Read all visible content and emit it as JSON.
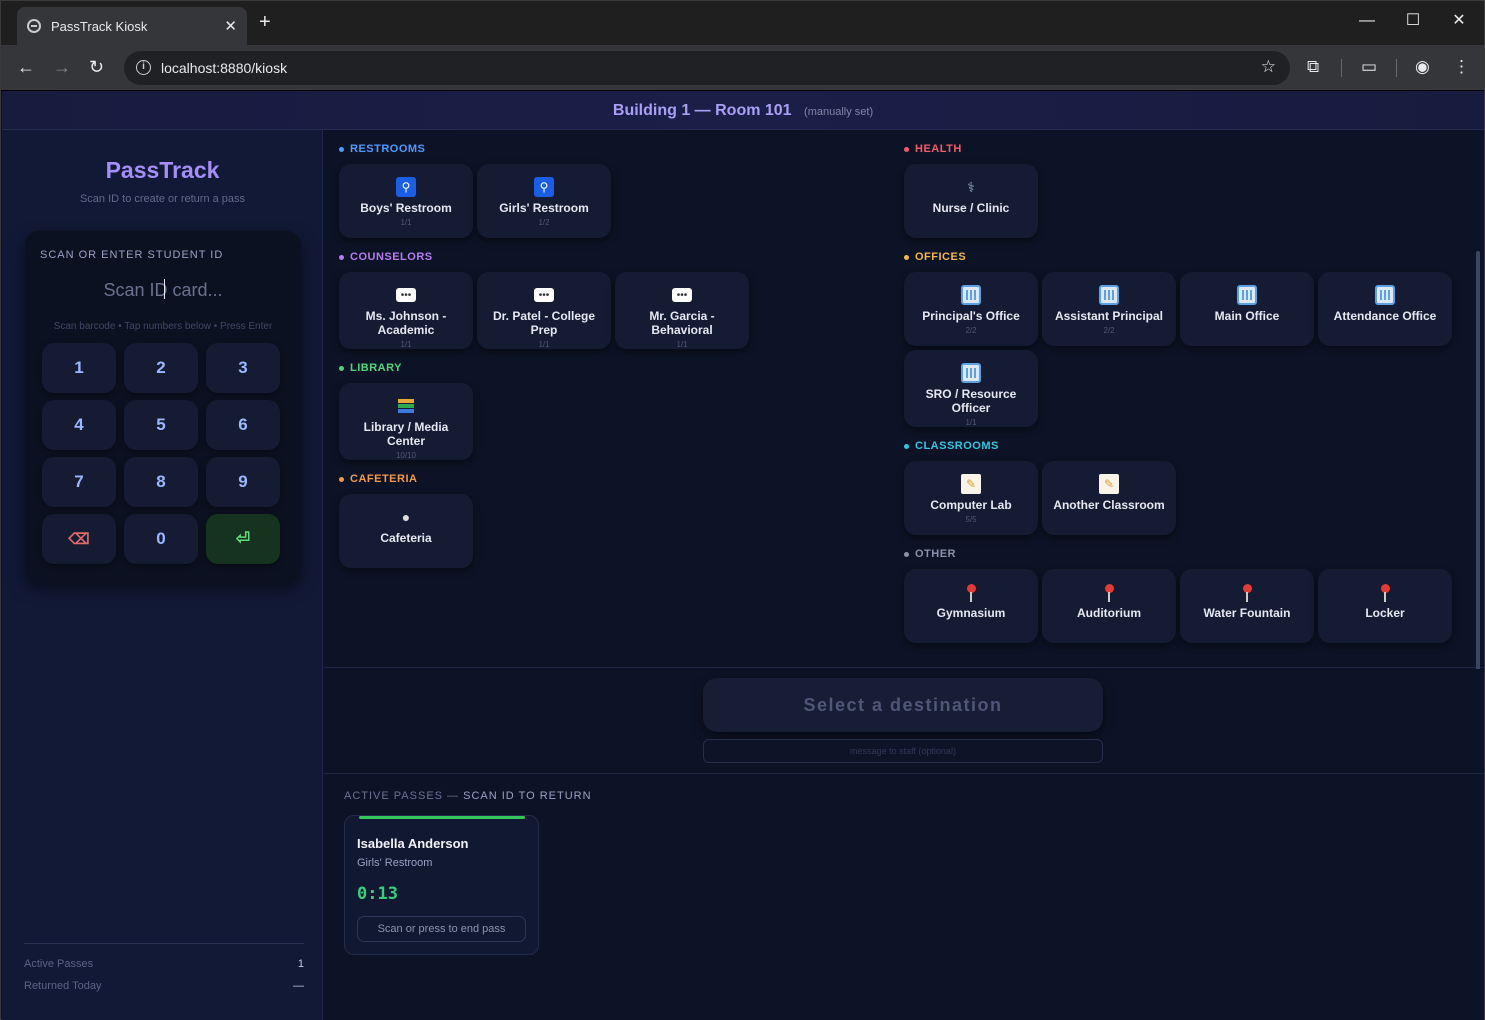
{
  "browser": {
    "tab_title": "PassTrack Kiosk",
    "url": "localhost:8880/kiosk",
    "icons": [
      "globe-icon",
      "close-icon",
      "plus-icon",
      "back-icon",
      "forward-icon",
      "reload-icon",
      "info-icon",
      "star-icon",
      "extensions-icon",
      "media-icon",
      "profile-icon",
      "menu-icon"
    ]
  },
  "topbar": {
    "room": "Building 1 — Room 101",
    "mode": "(manually set)"
  },
  "sidebar": {
    "brand": "PassTrack",
    "tagline": "Scan ID to create or return a pass",
    "scan_label": "SCAN OR ENTER STUDENT ID",
    "scan_placeholder": "Scan ID card...",
    "hint": "Scan barcode • Tap numbers below • Press Enter",
    "keys": [
      "1",
      "2",
      "3",
      "4",
      "5",
      "6",
      "7",
      "8",
      "9",
      "⌫",
      "0",
      "⏎"
    ],
    "stats": [
      {
        "label": "Active Passes",
        "value": "1"
      },
      {
        "label": "Returned Today",
        "value": "—"
      }
    ]
  },
  "categories": {
    "restrooms": {
      "title": "RESTROOMS",
      "color": "#4f9bff",
      "items": [
        {
          "name": "Boys' Restroom",
          "count": "1/1",
          "icon": "restroom-icon"
        },
        {
          "name": "Girls' Restroom",
          "count": "1/2",
          "icon": "restroom-icon"
        }
      ]
    },
    "counselors": {
      "title": "COUNSELORS",
      "color": "#b67cf2",
      "items": [
        {
          "name": "Ms. Johnson - Academic",
          "count": "1/1",
          "icon": "speech-bubble-icon"
        },
        {
          "name": "Dr. Patel - College Prep",
          "count": "1/1",
          "icon": "speech-bubble-icon"
        },
        {
          "name": "Mr. Garcia - Behavioral",
          "count": "1/1",
          "icon": "speech-bubble-icon"
        }
      ]
    },
    "library": {
      "title": "LIBRARY",
      "color": "#4cd67a",
      "items": [
        {
          "name": "Library / Media Center",
          "count": "10/10",
          "icon": "books-icon"
        }
      ]
    },
    "cafeteria": {
      "title": "CAFETERIA",
      "color": "#f2994a",
      "items": [
        {
          "name": "Cafeteria",
          "count": "",
          "icon": "plate-icon"
        }
      ]
    },
    "health": {
      "title": "HEALTH",
      "color": "#f25c6a",
      "items": [
        {
          "name": "Nurse / Clinic",
          "count": "",
          "icon": "stethoscope-icon"
        }
      ]
    },
    "offices": {
      "title": "OFFICES",
      "color": "#f2b84a",
      "items": [
        {
          "name": "Principal's Office",
          "count": "2/2",
          "icon": "office-building-icon"
        },
        {
          "name": "Assistant Principal",
          "count": "2/2",
          "icon": "office-building-icon"
        },
        {
          "name": "Main Office",
          "count": "",
          "icon": "office-building-icon"
        },
        {
          "name": "Attendance Office",
          "count": "",
          "icon": "office-building-icon"
        },
        {
          "name": "SRO / Resource Officer",
          "count": "1/1",
          "icon": "office-building-icon"
        }
      ]
    },
    "classrooms": {
      "title": "CLASSROOMS",
      "color": "#2fc6e0",
      "items": [
        {
          "name": "Computer Lab",
          "count": "5/5",
          "icon": "memo-icon"
        },
        {
          "name": "Another Classroom",
          "count": "",
          "icon": "memo-icon"
        }
      ]
    },
    "other": {
      "title": "OTHER",
      "color": "#8a92ad",
      "items": [
        {
          "name": "Gymnasium",
          "count": "",
          "icon": "pin-icon"
        },
        {
          "name": "Auditorium",
          "count": "",
          "icon": "pin-icon"
        },
        {
          "name": "Water Fountain",
          "count": "",
          "icon": "pin-icon"
        },
        {
          "name": "Locker",
          "count": "",
          "icon": "pin-icon"
        }
      ]
    }
  },
  "send": {
    "button": "Select a destination",
    "message_placeholder": "message to staff (optional)"
  },
  "passes": {
    "title_prefix": "ACTIVE PASSES — ",
    "title_suffix": "SCAN ID TO RETURN",
    "items": [
      {
        "student": "Isabella Anderson",
        "destination": "Girls' Restroom",
        "elapsed": "0:13",
        "end_label": "Scan or press to end pass"
      }
    ]
  }
}
